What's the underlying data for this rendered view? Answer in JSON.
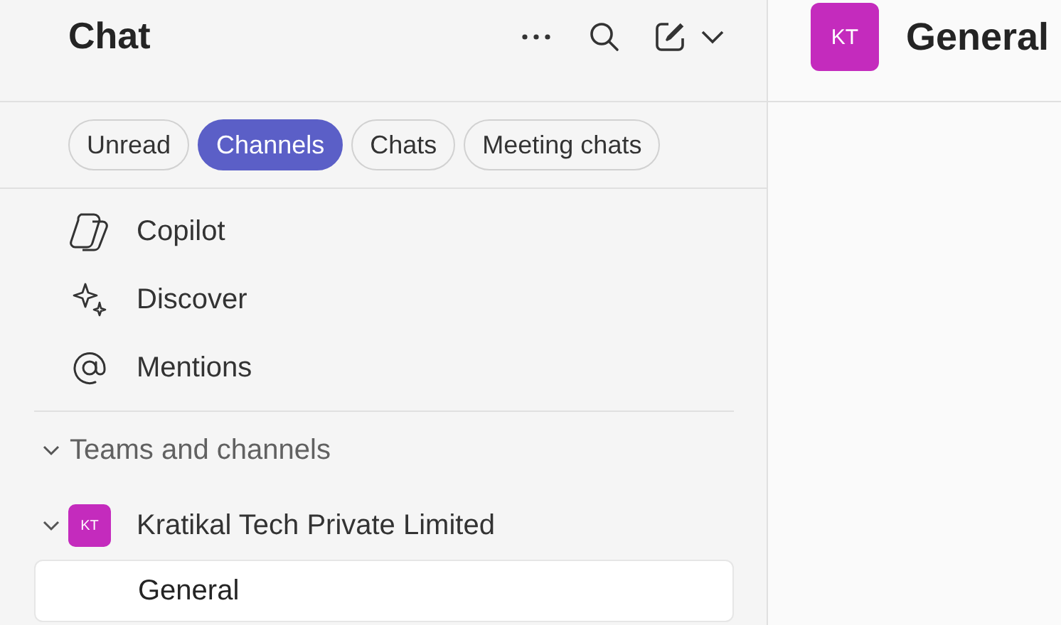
{
  "sidebar": {
    "title": "Chat",
    "filters": [
      {
        "label": "Unread",
        "selected": false
      },
      {
        "label": "Channels",
        "selected": true
      },
      {
        "label": "Chats",
        "selected": false
      },
      {
        "label": "Meeting chats",
        "selected": false
      }
    ],
    "nav_items": [
      {
        "label": "Copilot",
        "kind": "copilot"
      },
      {
        "label": "Discover",
        "kind": "discover"
      },
      {
        "label": "Mentions",
        "kind": "mentions"
      }
    ],
    "section": {
      "label": "Teams and channels",
      "expanded": true,
      "teams": [
        {
          "name": "Kratikal Tech Private Limited",
          "initials": "KT",
          "color": "#c42bbd",
          "expanded": true,
          "channels": [
            {
              "name": "General",
              "selected": true
            }
          ]
        }
      ]
    }
  },
  "main": {
    "avatar_initials": "KT",
    "title": "General"
  }
}
